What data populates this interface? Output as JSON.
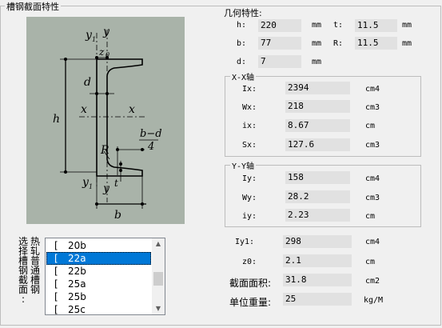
{
  "main_group": {
    "title": "槽钢截面特性"
  },
  "geometry": {
    "title": "几何特性:",
    "h": {
      "label": "h:",
      "value": "220",
      "unit": "mm"
    },
    "t": {
      "label": "t:",
      "value": "11.5",
      "unit": "mm"
    },
    "b": {
      "label": "b:",
      "value": "77",
      "unit": "mm"
    },
    "R": {
      "label": "R:",
      "value": "11.5",
      "unit": "mm"
    },
    "d": {
      "label": "d:",
      "value": "7",
      "unit": "mm"
    }
  },
  "xx_axis": {
    "title": "X-X轴",
    "rows": [
      {
        "label": "Ix:",
        "value": "2394",
        "unit": "cm4"
      },
      {
        "label": "Wx:",
        "value": "218",
        "unit": "cm3"
      },
      {
        "label": "ix:",
        "value": "8.67",
        "unit": "cm"
      },
      {
        "label": "Sx:",
        "value": "127.6",
        "unit": "cm3"
      }
    ]
  },
  "yy_axis": {
    "title": "Y-Y轴",
    "rows": [
      {
        "label": "Iy:",
        "value": "158",
        "unit": "cm4"
      },
      {
        "label": "Wy:",
        "value": "28.2",
        "unit": "cm3"
      },
      {
        "label": "iy:",
        "value": "2.23",
        "unit": "cm"
      }
    ]
  },
  "other": {
    "rows": [
      {
        "label": "Iy1:",
        "value": "298",
        "unit": "cm4"
      },
      {
        "label": "z0:",
        "value": "2.1",
        "unit": "cm"
      },
      {
        "label": "截面面积:",
        "value": "31.8",
        "unit": "cm2"
      },
      {
        "label": "单位重量:",
        "value": "25",
        "unit": "kg/M"
      }
    ]
  },
  "selector": {
    "label_col1": [
      "选",
      "择",
      "槽",
      "钢",
      "截",
      "面",
      ":"
    ],
    "label_col2": [
      "热",
      "轧",
      "普",
      "通",
      "槽",
      "钢"
    ],
    "items": [
      {
        "bracket": "[",
        "name": "20b"
      },
      {
        "bracket": "[",
        "name": "22a"
      },
      {
        "bracket": "[",
        "name": "22b"
      },
      {
        "bracket": "[",
        "name": "25a"
      },
      {
        "bracket": "[",
        "name": "25b"
      },
      {
        "bracket": "[",
        "name": "25c"
      }
    ],
    "selected": "22a"
  },
  "diagram": {
    "labels": {
      "y1_top": "y",
      "y1_top_sub": "1",
      "y_top": "y",
      "z0": "z",
      "z0_sub": "0",
      "d": "d",
      "h": "h",
      "x_left": "x",
      "x_right": "x",
      "bd_num": "b−d",
      "bd_den": "4",
      "R": "R",
      "t": "t",
      "y1_bot": "y",
      "y1_bot_sub": "1",
      "y_bot": "y",
      "b": "b"
    },
    "bg_color": "#a9b3a9"
  },
  "colors": {
    "selection": "#0078d7",
    "field_bg": "#e1e1e1"
  }
}
